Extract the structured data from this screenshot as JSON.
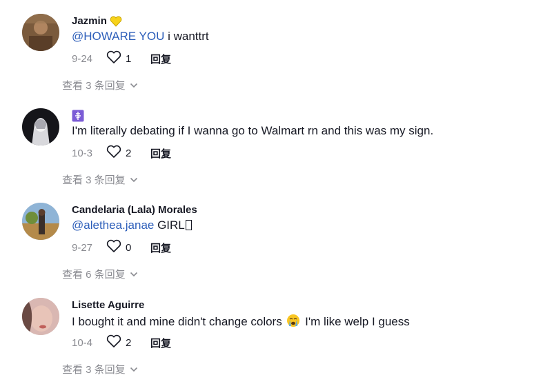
{
  "comments": [
    {
      "username": "Jazmin",
      "badge": "yellow-heart-emoji",
      "mention": "@HOWARE YOU",
      "text": " i wanttrt",
      "date": "9-24",
      "likes": "1",
      "reply_label": "回复",
      "view_replies": "查看 3 条回复",
      "avatar": "avatar-photo-brown"
    },
    {
      "username": "",
      "badge": "purple-cross-emoji",
      "mention": "",
      "text": "I'm literally debating if I wanna go to Walmart rn and this was my sign.",
      "date": "10-3",
      "likes": "2",
      "reply_label": "回复",
      "view_replies": "查看 3 条回复",
      "avatar": "avatar-anime-dark"
    },
    {
      "username": "Candelaria (Lala) Morales",
      "badge": "",
      "mention": "@alethea.janae",
      "text": " GIRL",
      "date": "9-27",
      "likes": "0",
      "reply_label": "回复",
      "view_replies": "查看 6 条回复",
      "avatar": "avatar-photo-outdoor"
    },
    {
      "username": "Lisette Aguirre",
      "badge": "",
      "mention": "",
      "text_before": "I bought it and mine didn't change colors ",
      "text_after": " I'm like welp I guess",
      "date": "10-4",
      "likes": "2",
      "reply_label": "回复",
      "view_replies": "查看 3 条回复",
      "avatar": "avatar-photo-pink"
    }
  ],
  "colors": {
    "mention": "#2b5db9",
    "primary_text": "#161823",
    "secondary_text": "#8a8b91"
  }
}
